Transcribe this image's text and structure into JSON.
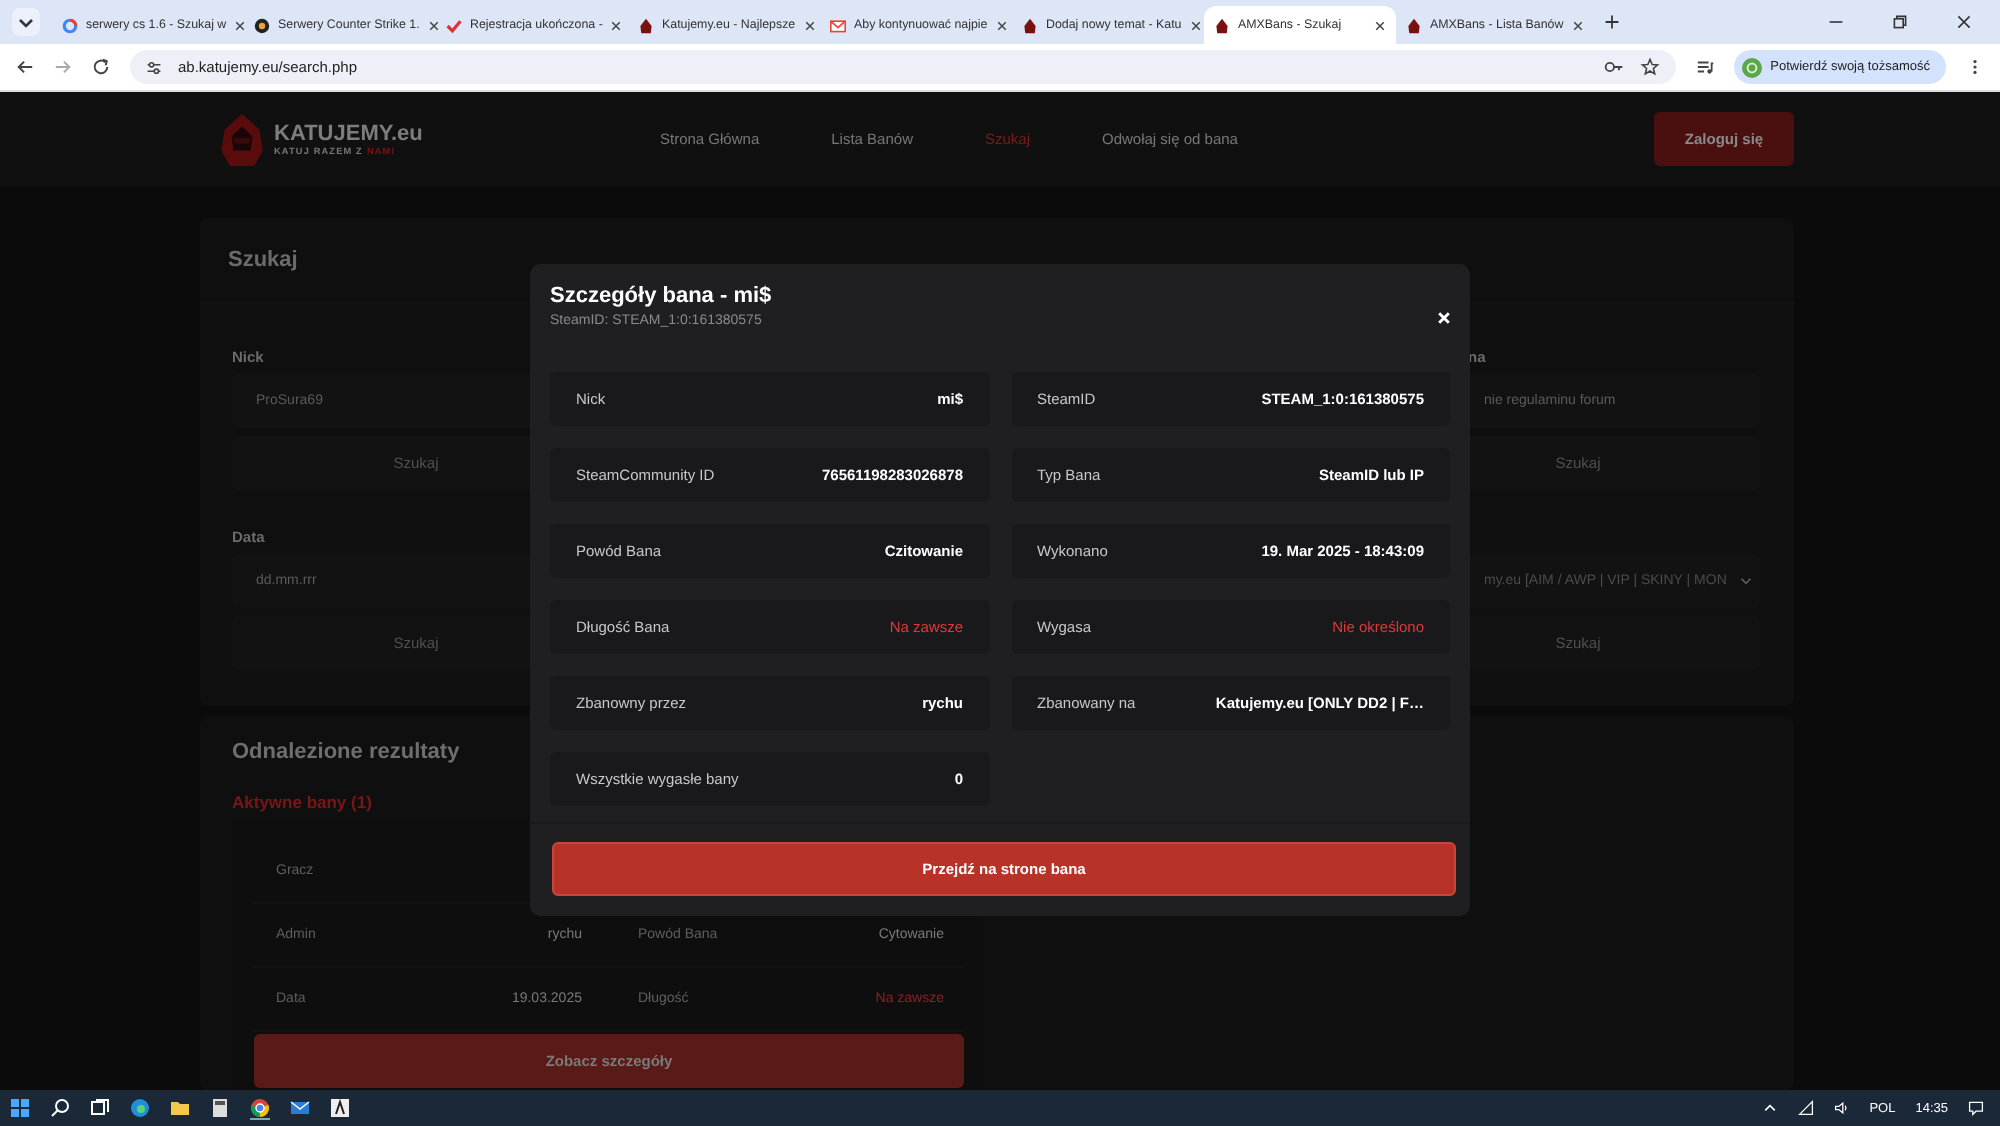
{
  "browser": {
    "tabs": [
      {
        "title": "serwery cs 1.6 - Szukaj w",
        "kind": "ring",
        "selected": false
      },
      {
        "title": "Serwery Counter Strike 1.",
        "kind": "disc",
        "selected": false
      },
      {
        "title": "Rejestracja ukończona -",
        "kind": "check",
        "selected": false
      },
      {
        "title": "Katujemy.eu - Najlepsze",
        "kind": "hood",
        "selected": false
      },
      {
        "title": "Aby kontynuować najpie",
        "kind": "mail",
        "selected": false
      },
      {
        "title": "Dodaj nowy temat - Katu",
        "kind": "hood",
        "selected": false
      },
      {
        "title": "AMXBans - Szukaj",
        "kind": "hood",
        "selected": true
      },
      {
        "title": "AMXBans - Lista Banów",
        "kind": "hood",
        "selected": false
      }
    ],
    "address": "ab.katujemy.eu/search.php",
    "profile_label": "Potwierdź swoją tożsamość"
  },
  "site": {
    "brand": "KATUJEMY.eu",
    "tagline": "KATUJ RAZEM Z",
    "tagline_highlight": "NAMI",
    "nav": [
      {
        "label": "Strona Główna",
        "selected": false
      },
      {
        "label": "Lista Banów",
        "selected": false
      },
      {
        "label": "Szukaj",
        "selected": true
      },
      {
        "label": "Odwołaj się od bana",
        "selected": false
      }
    ],
    "login_button": "Zaloguj się"
  },
  "search_card": {
    "title": "Szukaj",
    "left": [
      {
        "label": "Nick",
        "placeholder": "ProSura69",
        "button": "Szukaj"
      },
      {
        "label": "Data",
        "placeholder": "dd.mm.rrr",
        "button": "Szukaj"
      }
    ],
    "right": [
      {
        "kind": "input",
        "label": "na",
        "placeholder": "nie regulaminu forum",
        "button": "Szukaj"
      },
      {
        "kind": "select",
        "value": "my.eu [AIM / AWP | VIP | SKINY | MON",
        "button": "Szukaj"
      }
    ]
  },
  "results": {
    "title": "Odnalezione rezultaty",
    "active_title": "Aktywne bany (1)",
    "rows": [
      {
        "cells": [
          {
            "label": "Gracz"
          }
        ]
      },
      {
        "cells": [
          {
            "label": "Admin",
            "value": "rychu",
            "alert": false
          },
          {
            "label": "Powód Bana",
            "value": "Cytowanie",
            "alert": false
          }
        ]
      },
      {
        "cells": [
          {
            "label": "Data",
            "value": "19.03.2025",
            "alert": false
          },
          {
            "label": "Długość",
            "value": "Na zawsze",
            "alert": true
          }
        ]
      }
    ],
    "details_button": "Zobacz szczegóły"
  },
  "modal": {
    "title": "Szczegóły bana - mi$",
    "subtitle": "SteamID: STEAM_1:0:161380575",
    "fields": [
      {
        "label": "Nick",
        "value": "mi$",
        "alert": false
      },
      {
        "label": "SteamID",
        "value": "STEAM_1:0:161380575",
        "alert": false
      },
      {
        "label": "SteamCommunity ID",
        "value": "76561198283026878",
        "alert": false
      },
      {
        "label": "Typ Bana",
        "value": "SteamID lub IP",
        "alert": false
      },
      {
        "label": "Powód Bana",
        "value": "Czitowanie",
        "alert": false
      },
      {
        "label": "Wykonano",
        "value": "19. Mar 2025 - 18:43:09",
        "alert": false
      },
      {
        "label": "Długość Bana",
        "value": "Na zawsze",
        "alert": true
      },
      {
        "label": "Wygasa",
        "value": "Nie określono",
        "alert": true
      },
      {
        "label": "Zbanowny przez",
        "value": "rychu",
        "alert": false
      },
      {
        "label": "Zbanowany na",
        "value": "Katujemy.eu [ONLY DD2 | F…",
        "alert": false
      },
      {
        "label": "Wszystkie wygasłe bany",
        "value": "0",
        "alert": false
      }
    ],
    "button": "Przejdź na strone bana"
  },
  "taskbar": {
    "language": "POL",
    "time": "14:35"
  }
}
